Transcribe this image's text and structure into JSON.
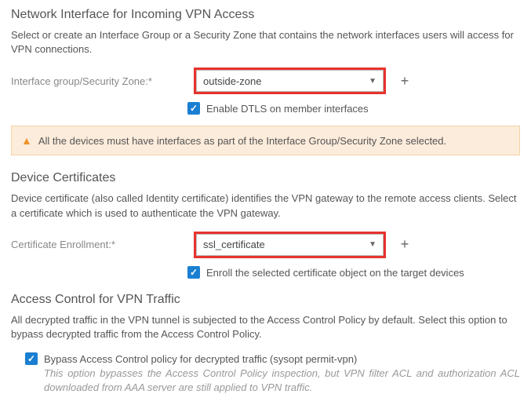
{
  "network": {
    "title": "Network Interface for Incoming VPN Access",
    "desc": "Select or create an Interface Group or a Security Zone that contains the network interfaces users will access for VPN connections.",
    "label": "Interface group/Security Zone:*",
    "select_value": "outside-zone",
    "checkbox_label": "Enable DTLS on member interfaces",
    "alert": "All the devices must have interfaces as part of the Interface Group/Security Zone selected."
  },
  "cert": {
    "title": "Device Certificates",
    "desc": "Device certificate (also called Identity certificate) identifies the VPN gateway to the remote access clients. Select a certificate which is used to authenticate the VPN gateway.",
    "label": "Certificate Enrollment:*",
    "select_value": "ssl_certificate",
    "checkbox_label": "Enroll the selected certificate object on the target devices"
  },
  "access": {
    "title": "Access Control for VPN Traffic",
    "desc": "All decrypted traffic in the VPN tunnel is subjected to the Access Control Policy by default. Select this option to bypass decrypted traffic from the Access Control Policy.",
    "bypass_label": "Bypass Access Control policy for decrypted traffic (sysopt permit-vpn)",
    "bypass_sub": "This option bypasses the Access Control Policy inspection, but VPN filter ACL and authorization ACL downloaded from AAA server are still applied to VPN traffic."
  }
}
